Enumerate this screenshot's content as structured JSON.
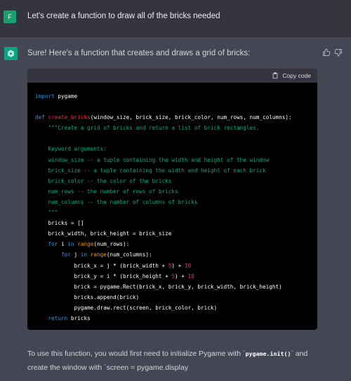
{
  "user": {
    "avatar_letter": "F",
    "message": "Let's create a function to draw all of the bricks needed"
  },
  "assistant": {
    "intro": "Sure! Here's a function that creates and draws a grid of bricks:",
    "copy_label": "Copy code",
    "code_lines": [
      [
        {
          "t": "import",
          "c": "kw"
        },
        {
          "t": " pygame"
        }
      ],
      [],
      [
        {
          "t": "def",
          "c": "kw"
        },
        {
          "t": " "
        },
        {
          "t": "create_bricks",
          "c": "fn"
        },
        {
          "t": "(window_size, brick_size, brick_color, num_rows, num_columns):"
        }
      ],
      [
        {
          "t": "    "
        },
        {
          "t": "\"\"\"Create a grid of bricks and return a list of brick rectangles.",
          "c": "cm"
        }
      ],
      [],
      [
        {
          "t": "    Keyword arguments:",
          "c": "cm"
        }
      ],
      [
        {
          "t": "    window_size -- a tuple containing the width and height of the window",
          "c": "cm"
        }
      ],
      [
        {
          "t": "    brick_size -- a tuple containing the width and height of each brick",
          "c": "cm"
        }
      ],
      [
        {
          "t": "    brick_color -- the color of the bricks",
          "c": "cm"
        }
      ],
      [
        {
          "t": "    num_rows -- the number of rows of bricks",
          "c": "cm"
        }
      ],
      [
        {
          "t": "    num_columns -- the number of columns of bricks",
          "c": "cm"
        }
      ],
      [
        {
          "t": "    \"\"\"",
          "c": "cm"
        }
      ],
      [
        {
          "t": "    bricks = []"
        }
      ],
      [
        {
          "t": "    brick_width, brick_height = brick_size"
        }
      ],
      [
        {
          "t": "    "
        },
        {
          "t": "for",
          "c": "kw"
        },
        {
          "t": " i "
        },
        {
          "t": "in",
          "c": "kw"
        },
        {
          "t": " "
        },
        {
          "t": "range",
          "c": "bi"
        },
        {
          "t": "(num_rows):"
        }
      ],
      [
        {
          "t": "        "
        },
        {
          "t": "for",
          "c": "kw"
        },
        {
          "t": " j "
        },
        {
          "t": "in",
          "c": "kw"
        },
        {
          "t": " "
        },
        {
          "t": "range",
          "c": "bi"
        },
        {
          "t": "(num_columns):"
        }
      ],
      [
        {
          "t": "            brick_x = j * (brick_width + "
        },
        {
          "t": "5",
          "c": "nm"
        },
        {
          "t": ") + "
        },
        {
          "t": "10",
          "c": "nm"
        }
      ],
      [
        {
          "t": "            brick_y = i * (brick_height + "
        },
        {
          "t": "5",
          "c": "nm"
        },
        {
          "t": ") + "
        },
        {
          "t": "10",
          "c": "nm"
        }
      ],
      [
        {
          "t": "            brick = pygame.Rect(brick_x, brick_y, brick_width, brick_height)"
        }
      ],
      [
        {
          "t": "            bricks.append(brick)"
        }
      ],
      [
        {
          "t": "            pygame.draw.rect(screen, brick_color, brick)"
        }
      ],
      [
        {
          "t": "    "
        },
        {
          "t": "return",
          "c": "kw"
        },
        {
          "t": " bricks"
        }
      ]
    ],
    "footer_part1": "To use this function, you would first need to initialize Pygame with `",
    "footer_code": "pygame.init()",
    "footer_part2": "` and create the window with `screen = pygame.display"
  },
  "icons": {
    "thumbs_up": "thumbs-up-icon",
    "thumbs_down": "thumbs-down-icon",
    "copy": "clipboard-icon",
    "bot": "openai-logo-icon"
  },
  "colors": {
    "accent": "#10a37f",
    "user_avatar": "#19a06d",
    "bg_user": "#343541",
    "bg_assistant": "#444654"
  }
}
